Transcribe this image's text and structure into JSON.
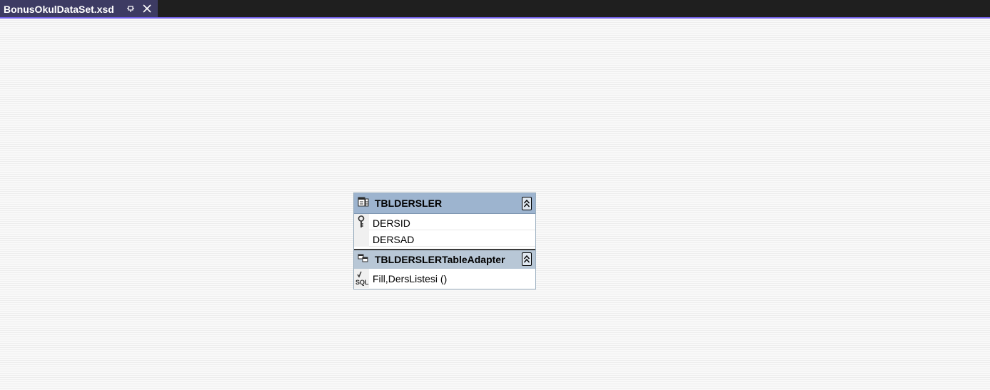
{
  "tab": {
    "title": "BonusOkulDataSet.xsd",
    "pin_icon": "pin-icon",
    "close_icon": "close-icon",
    "accent": "#7160e8"
  },
  "datatable": {
    "name": "TBLDERSLER",
    "icon": "datatable-icon",
    "collapse_icon": "collapse-icon",
    "header_color": "#9db4cf",
    "columns": [
      {
        "name": "DERSID",
        "is_key": true
      },
      {
        "name": "DERSAD",
        "is_key": false
      }
    ],
    "table_adapter": {
      "name": "TBLDERSLERTableAdapter",
      "icon": "table-adapter-icon",
      "queries": [
        {
          "name": "Fill,DersListesi ()",
          "icon": "sql-query-icon"
        }
      ]
    }
  }
}
